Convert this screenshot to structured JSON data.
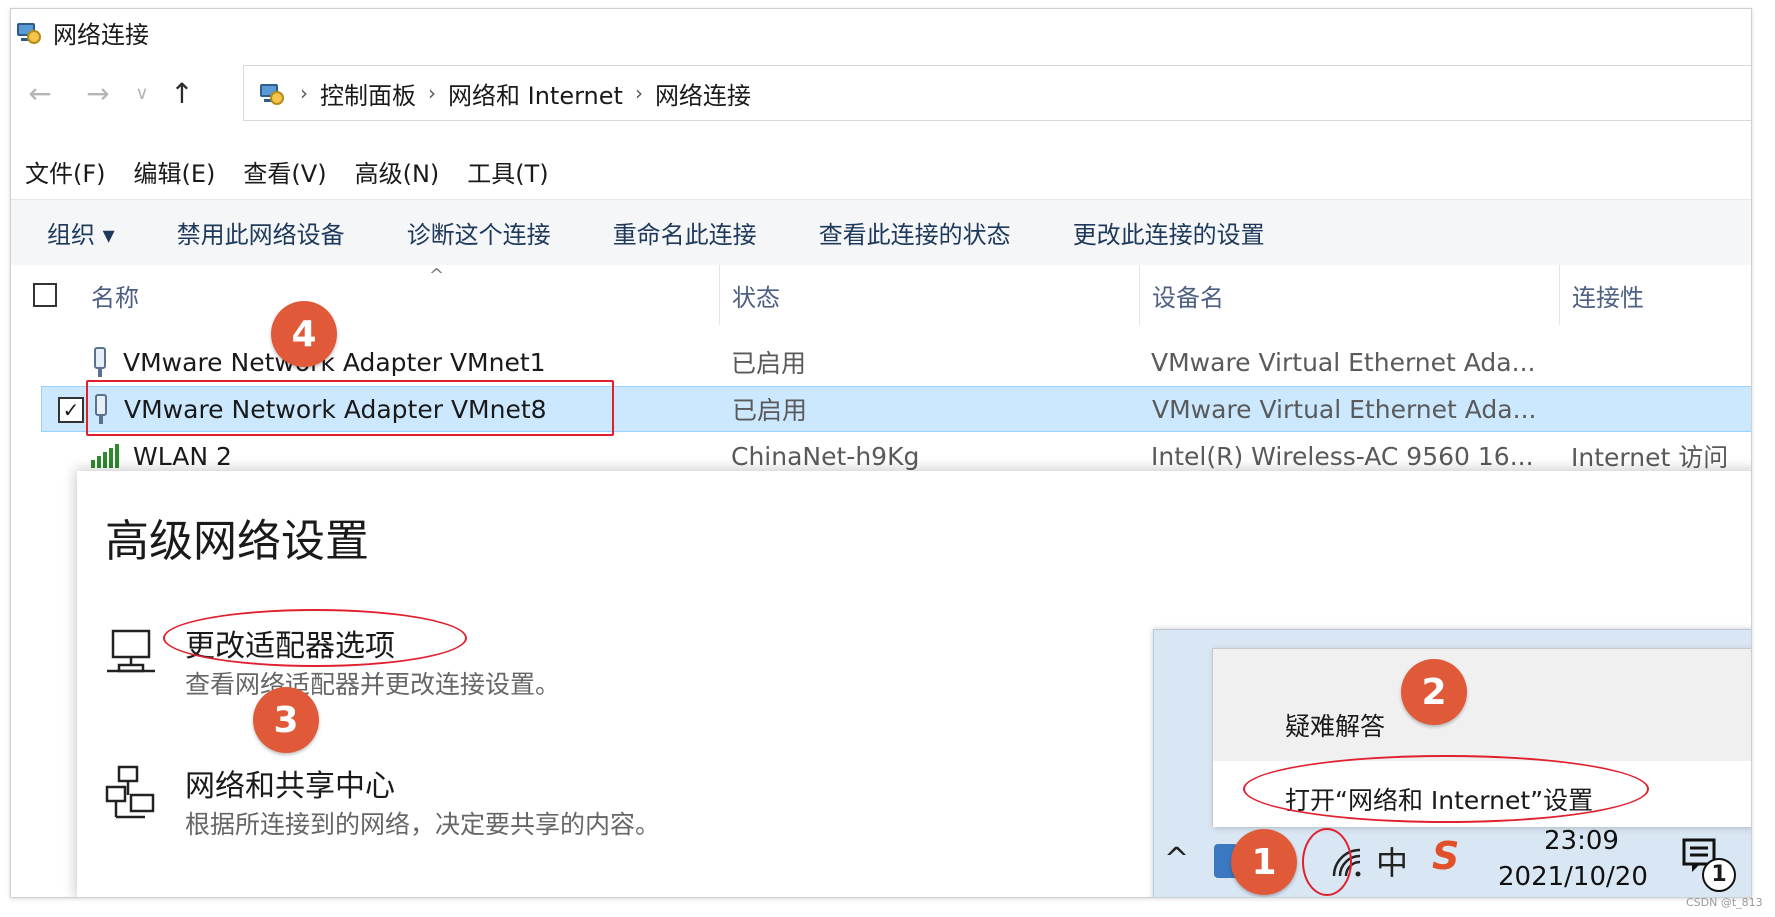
{
  "window": {
    "title": "网络连接"
  },
  "nav": {
    "back": "←",
    "forward": "→",
    "recent": "∨",
    "up": "↑",
    "separator": "›"
  },
  "breadcrumb": [
    "控制面板",
    "网络和 Internet",
    "网络连接"
  ],
  "menu": [
    "文件(F)",
    "编辑(E)",
    "查看(V)",
    "高级(N)",
    "工具(T)"
  ],
  "commands": [
    "组织 ▾",
    "禁用此网络设备",
    "诊断这个连接",
    "重命名此连接",
    "查看此连接的状态",
    "更改此连接的设置"
  ],
  "columns": {
    "name": "名称",
    "status": "状态",
    "device": "设备名",
    "connectivity": "连接性",
    "sort_caret": "^"
  },
  "rows": [
    {
      "name": "VMware Network Adapter VMnet1",
      "status": "已启用",
      "device": "VMware Virtual Ethernet Ada...",
      "connectivity": "",
      "icon": "network-adapter-icon"
    },
    {
      "name": "VMware Network Adapter VMnet8",
      "status": "已启用",
      "device": "VMware Virtual Ethernet Ada...",
      "connectivity": "",
      "icon": "network-adapter-icon",
      "selected": true,
      "check": "✓"
    },
    {
      "name": "WLAN 2",
      "status": "ChinaNet-h9Kg",
      "device": "Intel(R) Wireless-AC 9560 16...",
      "connectivity": "Internet 访问",
      "icon": "wifi-signal-icon"
    }
  ],
  "advanced": {
    "heading": "高级网络设置",
    "options": [
      {
        "title": "更改适配器选项",
        "desc": "查看网络适配器并更改连接设置。",
        "icon": "monitor-icon"
      },
      {
        "title": "网络和共享中心",
        "desc": "根据所连接到的网络，决定要共享的内容。",
        "icon": "network-share-icon"
      }
    ]
  },
  "tray_menu": {
    "items": [
      "疑难解答",
      "打开“网络和 Internet”设置"
    ]
  },
  "taskbar": {
    "chevron": "^",
    "ime": "中",
    "sogou": "S",
    "time": "23:09",
    "date": "2021/10/20",
    "notification_count": "1"
  },
  "markers": [
    "1",
    "2",
    "3",
    "4"
  ],
  "watermark": "CSDN @t_813",
  "colors": {
    "annotation_red": "#e0202e",
    "marker_orange": "#e05a3a",
    "selection_blue": "#cce8ff"
  }
}
